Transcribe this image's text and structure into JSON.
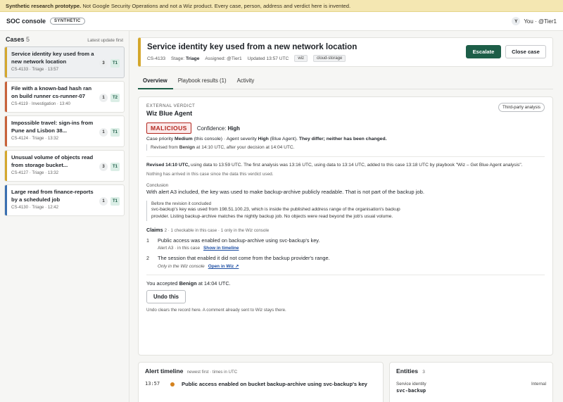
{
  "banner": {
    "bold": "Synthetic research prototype.",
    "text": "Not Google Security Operations and not a Wiz product. Every case, person, address and verdict here is invented."
  },
  "topbar": {
    "title": "SOC console",
    "pill": "SYNTHETIC",
    "avatar": "Y",
    "user": "You · @Tier1"
  },
  "sidebar": {
    "title": "Cases",
    "count": "5",
    "sort": "Latest update first",
    "cases": [
      {
        "title": "Service identity key used from a new network location",
        "meta": "CS-4133 · Triage · 13:57",
        "count": "3",
        "tier": "T1",
        "color": "#d4a72c"
      },
      {
        "title": "File with a known-bad hash ran on build runner cs-runner-07",
        "meta": "CS-4119 · Investigation · 13:40",
        "count": "1",
        "tier": "T2",
        "color": "#c8623a"
      },
      {
        "title": "Impossible travel: sign-ins from Pune and Lisbon 38...",
        "meta": "CS-4124 · Triage · 13:32",
        "count": "1",
        "tier": "T1",
        "color": "#c8623a"
      },
      {
        "title": "Unusual volume of objects read from storage bucket...",
        "meta": "CS-4127 · Triage · 13:32",
        "count": "3",
        "tier": "T1",
        "color": "#d4a72c"
      },
      {
        "title": "Large read from finance-reports by a scheduled job",
        "meta": "CS-4130 · Triage · 12:42",
        "count": "1",
        "tier": "T1",
        "color": "#3a6fb0"
      }
    ]
  },
  "header": {
    "title": "Service identity key used from a new network location",
    "id": "CS-4133",
    "stage_label": "Stage:",
    "stage": "Triage",
    "assigned": "Assigned: @Tier1",
    "updated": "Updated 13:57 UTC",
    "tags": [
      "wiz",
      "cloud-storage"
    ],
    "escalate": "Escalate",
    "close": "Close case"
  },
  "tabs": [
    "Overview",
    "Playbook results (1)",
    "Activity"
  ],
  "verdict": {
    "kicker": "EXTERNAL VERDICT",
    "agent": "Wiz Blue Agent",
    "third_party": "Third-party analysis",
    "label": "MALICIOUS",
    "confidence_label": "Confidence:",
    "confidence": "High",
    "priority_pre": "Case priority",
    "priority": "Medium",
    "priority_mid": "(this console) · Agent severity",
    "severity": "High",
    "priority_post": "(Blue Agent).",
    "differ": "They differ; neither has been changed.",
    "revised_pre": "Revised from",
    "revised_from": "Benign",
    "revised_post": "at 14:10 UTC, after your decision at 14:04 UTC.",
    "revision_bold": "Revised 14:10 UTC,",
    "revision_text": "using data to 13:59 UTC. The first analysis was 13:16 UTC, using data to 13:14 UTC, added to this case 13:18 UTC by playbook \"Wiz – Get Blue Agent analysis\".",
    "nothing": "Nothing has arrived in this case since the data this verdict used.",
    "conclusion_label": "Conclusion",
    "conclusion": "With alert A3 included, the key was used to make backup-archive publicly readable. That is not part of the backup job.",
    "before_label": "Before the revision it concluded",
    "before_text": "svc-backup's key was used from 198.51.100.23, which is inside the published address range of the organisation's backup provider. Listing backup-archive matches the nightly backup job. No objects were read beyond the job's usual volume.",
    "claims_label": "Claims",
    "claims_sub": "2 · 1 checkable in this case · 1 only in the Wiz console",
    "claims": [
      {
        "n": "1",
        "text": "Public access was enabled on backup-archive using svc-backup's key.",
        "sub": "Alert A3 · in this case",
        "link": "Show in timeline"
      },
      {
        "n": "2",
        "text": "The session that enabled it did not come from the backup provider's range.",
        "sub": "Only in the Wiz console",
        "link": "Open in Wiz ↗"
      }
    ],
    "accepted_pre": "You accepted",
    "accepted": "Benign",
    "accepted_post": "at 14:04 UTC.",
    "undo": "Undo this",
    "undo_note": "Undo clears the record here. A comment already sent to Wiz stays there."
  },
  "timeline": {
    "title": "Alert timeline",
    "sub": "newest first · times in UTC",
    "items": [
      {
        "time": "13:57",
        "text": "Public access enabled on bucket backup-archive using svc-backup's key"
      }
    ]
  },
  "entities": {
    "title": "Entities",
    "count": "3",
    "items": [
      {
        "type": "Service identity",
        "scope": "Internal",
        "name": "svc-backup"
      }
    ]
  }
}
